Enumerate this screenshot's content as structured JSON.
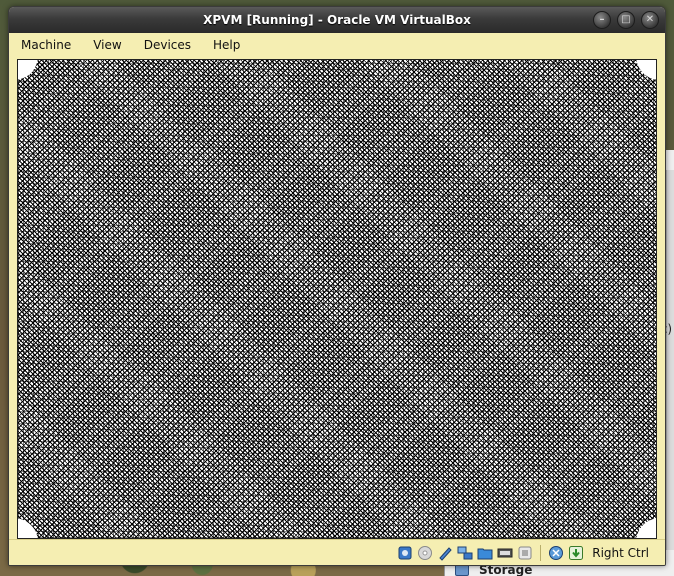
{
  "window": {
    "title": "XPVM [Running] - Oracle VM VirtualBox",
    "controls": [
      "minimize-icon",
      "maximize-icon",
      "close-icon"
    ]
  },
  "menubar": {
    "items": [
      {
        "label": "Machine"
      },
      {
        "label": "View"
      },
      {
        "label": "Devices"
      },
      {
        "label": "Help"
      }
    ]
  },
  "statusbar": {
    "icons": [
      "hard-disk-icon",
      "optical-drive-icon",
      "usb-icon",
      "network-icon",
      "shared-folders-icon",
      "display-icon",
      "video-capture-icon",
      "mouse-integration-icon",
      "host-key-icon"
    ],
    "host_key_label": "Right Ctrl"
  },
  "background_window": {
    "fragment": "c)",
    "section_label": "Storage"
  },
  "colors": {
    "window_frame": "#f5eeb2",
    "titlebar": "#3a3a3a",
    "title_text": "#ffffff",
    "vm_screen_fg": "#000000",
    "vm_screen_bg": "#ffffff"
  }
}
